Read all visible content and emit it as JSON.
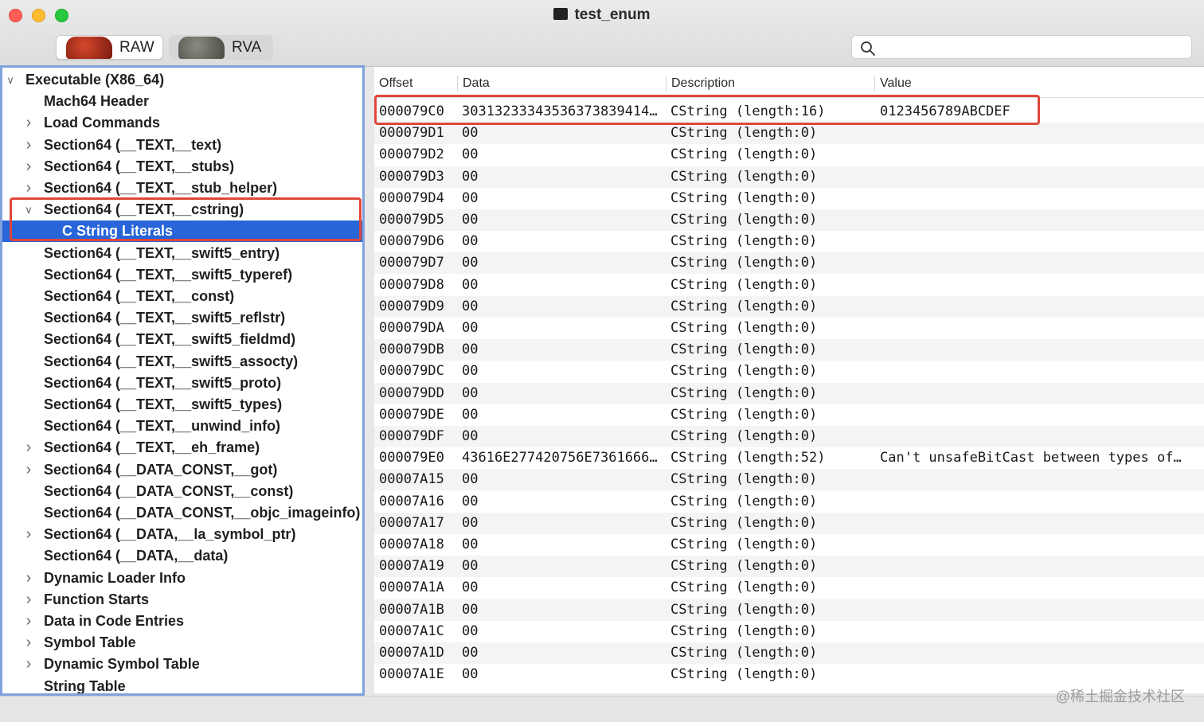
{
  "window": {
    "title": "test_enum"
  },
  "toolbar": {
    "raw_label": "RAW",
    "rva_label": "RVA",
    "search_placeholder": ""
  },
  "sidebar": {
    "items": [
      {
        "label": "Executable  (X86_64)",
        "chev": "down",
        "level": 0
      },
      {
        "label": "Mach64 Header",
        "chev": "none",
        "level": 1
      },
      {
        "label": "Load Commands",
        "chev": "right",
        "level": 1
      },
      {
        "label": "Section64 (__TEXT,__text)",
        "chev": "right",
        "level": 1
      },
      {
        "label": "Section64 (__TEXT,__stubs)",
        "chev": "right",
        "level": 1
      },
      {
        "label": "Section64 (__TEXT,__stub_helper)",
        "chev": "right",
        "level": 1
      },
      {
        "label": "Section64 (__TEXT,__cstring)",
        "chev": "down",
        "level": 1
      },
      {
        "label": "C String Literals",
        "chev": "none",
        "level": 2,
        "selected": true
      },
      {
        "label": "Section64 (__TEXT,__swift5_entry)",
        "chev": "none",
        "level": 1
      },
      {
        "label": "Section64 (__TEXT,__swift5_typeref)",
        "chev": "none",
        "level": 1
      },
      {
        "label": "Section64 (__TEXT,__const)",
        "chev": "none",
        "level": 1
      },
      {
        "label": "Section64 (__TEXT,__swift5_reflstr)",
        "chev": "none",
        "level": 1
      },
      {
        "label": "Section64 (__TEXT,__swift5_fieldmd)",
        "chev": "none",
        "level": 1
      },
      {
        "label": "Section64 (__TEXT,__swift5_assocty)",
        "chev": "none",
        "level": 1
      },
      {
        "label": "Section64 (__TEXT,__swift5_proto)",
        "chev": "none",
        "level": 1
      },
      {
        "label": "Section64 (__TEXT,__swift5_types)",
        "chev": "none",
        "level": 1
      },
      {
        "label": "Section64 (__TEXT,__unwind_info)",
        "chev": "none",
        "level": 1
      },
      {
        "label": "Section64 (__TEXT,__eh_frame)",
        "chev": "right",
        "level": 1
      },
      {
        "label": "Section64 (__DATA_CONST,__got)",
        "chev": "right",
        "level": 1
      },
      {
        "label": "Section64 (__DATA_CONST,__const)",
        "chev": "none",
        "level": 1
      },
      {
        "label": "Section64 (__DATA_CONST,__objc_imageinfo)",
        "chev": "none",
        "level": 1
      },
      {
        "label": "Section64 (__DATA,__la_symbol_ptr)",
        "chev": "right",
        "level": 1
      },
      {
        "label": "Section64 (__DATA,__data)",
        "chev": "none",
        "level": 1
      },
      {
        "label": "Dynamic Loader Info",
        "chev": "right",
        "level": 1
      },
      {
        "label": "Function Starts",
        "chev": "right",
        "level": 1
      },
      {
        "label": "Data in Code Entries",
        "chev": "right",
        "level": 1
      },
      {
        "label": "Symbol Table",
        "chev": "right",
        "level": 1
      },
      {
        "label": "Dynamic Symbol Table",
        "chev": "right",
        "level": 1
      },
      {
        "label": "String Table",
        "chev": "none",
        "level": 1
      }
    ]
  },
  "table": {
    "columns": [
      "Offset",
      "Data",
      "Description",
      "Value"
    ],
    "rows": [
      [
        "000079C0",
        "30313233343536373839414…",
        "CString (length:16)",
        "0123456789ABCDEF"
      ],
      [
        "000079D1",
        "00",
        "CString (length:0)",
        ""
      ],
      [
        "000079D2",
        "00",
        "CString (length:0)",
        ""
      ],
      [
        "000079D3",
        "00",
        "CString (length:0)",
        ""
      ],
      [
        "000079D4",
        "00",
        "CString (length:0)",
        ""
      ],
      [
        "000079D5",
        "00",
        "CString (length:0)",
        ""
      ],
      [
        "000079D6",
        "00",
        "CString (length:0)",
        ""
      ],
      [
        "000079D7",
        "00",
        "CString (length:0)",
        ""
      ],
      [
        "000079D8",
        "00",
        "CString (length:0)",
        ""
      ],
      [
        "000079D9",
        "00",
        "CString (length:0)",
        ""
      ],
      [
        "000079DA",
        "00",
        "CString (length:0)",
        ""
      ],
      [
        "000079DB",
        "00",
        "CString (length:0)",
        ""
      ],
      [
        "000079DC",
        "00",
        "CString (length:0)",
        ""
      ],
      [
        "000079DD",
        "00",
        "CString (length:0)",
        ""
      ],
      [
        "000079DE",
        "00",
        "CString (length:0)",
        ""
      ],
      [
        "000079DF",
        "00",
        "CString (length:0)",
        ""
      ],
      [
        "000079E0",
        "43616E277420756E7361666…",
        "CString (length:52)",
        "Can't unsafeBitCast between types of…"
      ],
      [
        "00007A15",
        "00",
        "CString (length:0)",
        ""
      ],
      [
        "00007A16",
        "00",
        "CString (length:0)",
        ""
      ],
      [
        "00007A17",
        "00",
        "CString (length:0)",
        ""
      ],
      [
        "00007A18",
        "00",
        "CString (length:0)",
        ""
      ],
      [
        "00007A19",
        "00",
        "CString (length:0)",
        ""
      ],
      [
        "00007A1A",
        "00",
        "CString (length:0)",
        ""
      ],
      [
        "00007A1B",
        "00",
        "CString (length:0)",
        ""
      ],
      [
        "00007A1C",
        "00",
        "CString (length:0)",
        ""
      ],
      [
        "00007A1D",
        "00",
        "CString (length:0)",
        ""
      ],
      [
        "00007A1E",
        "00",
        "CString (length:0)",
        ""
      ]
    ]
  },
  "watermark": "@稀土掘金技术社区",
  "colors": {
    "selection": "#2765d8",
    "annotation": "#e0463b",
    "focus_ring": "#7fa2dd"
  }
}
